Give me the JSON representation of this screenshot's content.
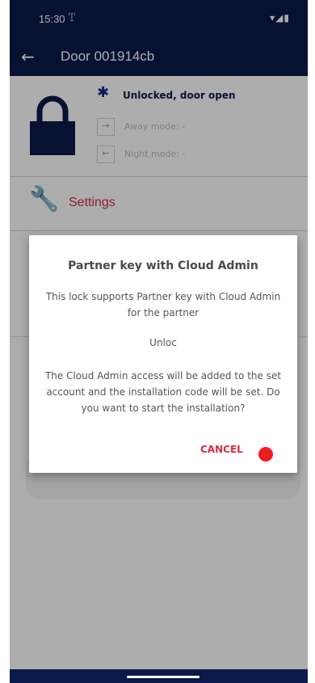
{
  "status_bar": {
    "time": "15:30",
    "signal_icon": "antenna-icon",
    "right_icons": "▾◢▮"
  },
  "app_bar": {
    "back_icon": "←",
    "title": "Door 001914cb"
  },
  "lock_card": {
    "status": "Unlocked, door open",
    "away_mode": "Away mode: -",
    "night_mode": "Night mode: -"
  },
  "settings": {
    "label": "Settings"
  },
  "dialog": {
    "title": "Partner key with Cloud Admin",
    "text1": "This lock supports Partner key with Cloud Admin for the partner",
    "text2": "Unloc",
    "text3": "The Cloud Admin access will be added to the set account and the installation code will be set. Do you want to start the installation?",
    "cancel_label": "CANCEL"
  },
  "colors": {
    "primary_dark": "#0b1a4a",
    "accent_red": "#d62b45",
    "ok_dot": "#ee1c24"
  }
}
